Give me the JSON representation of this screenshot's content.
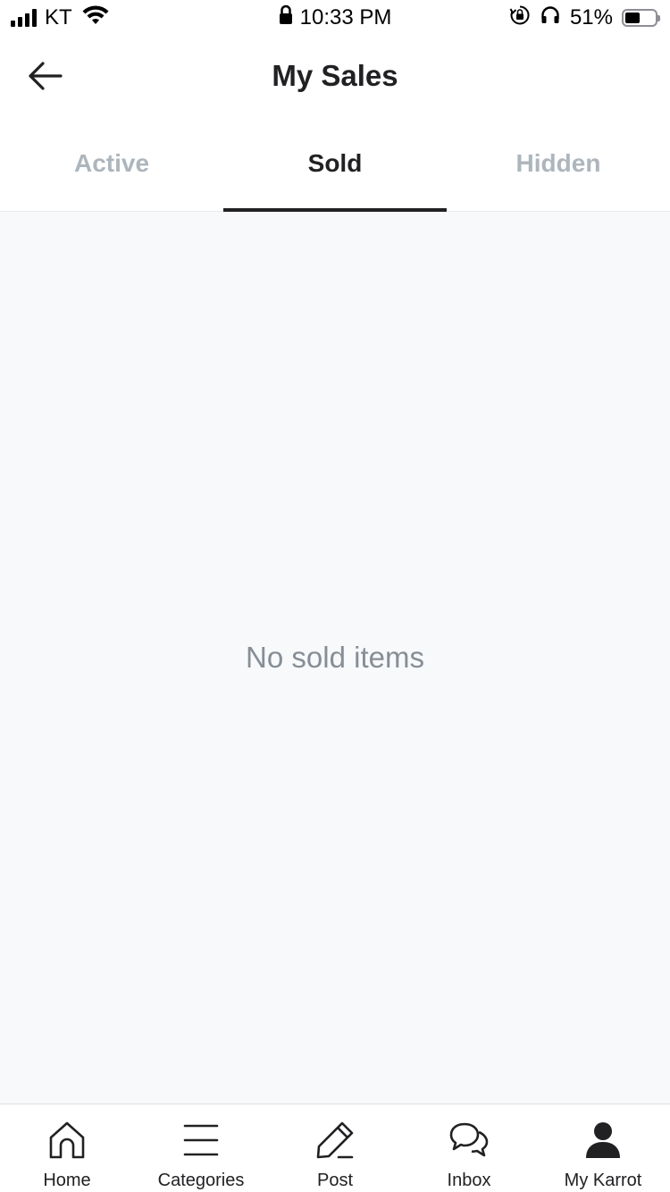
{
  "status_bar": {
    "carrier": "KT",
    "time": "10:33 PM",
    "battery_percent": "51%",
    "battery_level": 0.51,
    "icons": [
      "signal-icon",
      "wifi-icon",
      "lock-icon",
      "rotation-lock-icon",
      "headphones-icon",
      "battery-icon"
    ]
  },
  "header": {
    "title": "My Sales",
    "back_icon": "arrow-left-icon"
  },
  "tabs": [
    {
      "label": "Active",
      "selected": false
    },
    {
      "label": "Sold",
      "selected": true
    },
    {
      "label": "Hidden",
      "selected": false
    }
  ],
  "content": {
    "empty_message": "No sold items"
  },
  "bottom_nav": {
    "items": [
      {
        "label": "Home",
        "icon": "home-icon"
      },
      {
        "label": "Categories",
        "icon": "menu-icon"
      },
      {
        "label": "Post",
        "icon": "pencil-icon"
      },
      {
        "label": "Inbox",
        "icon": "chat-icon"
      },
      {
        "label": "My Karrot",
        "icon": "person-icon"
      }
    ]
  },
  "colors": {
    "text_primary": "#212124",
    "text_muted": "#adb5bd",
    "empty_text": "#868e96",
    "content_background": "#f8f9fa"
  }
}
